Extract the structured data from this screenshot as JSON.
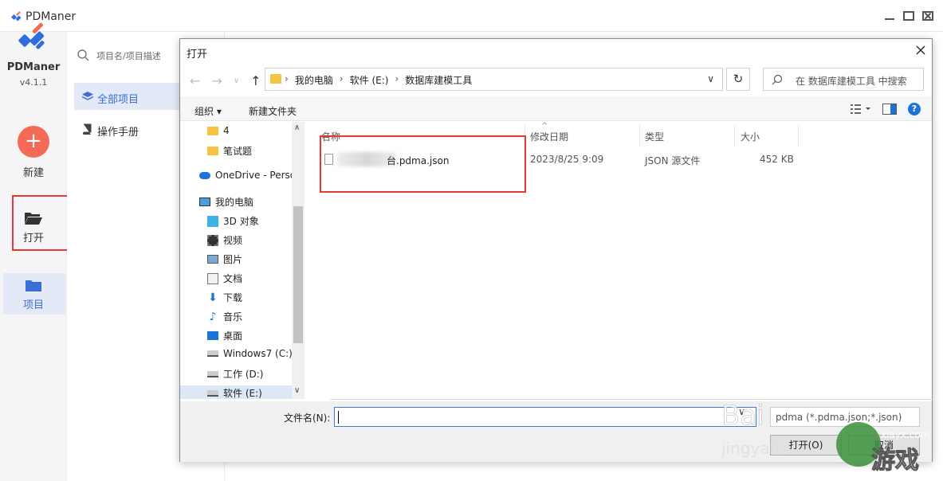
{
  "app": {
    "title": "PDManer",
    "brand": "PDManer",
    "version": "v4.1.1"
  },
  "sidebar": {
    "new_label": "新建",
    "open_label": "打开",
    "project_label": "项目"
  },
  "nav": {
    "search_placeholder": "项目名/项目描述",
    "items": [
      {
        "label": "全部项目"
      },
      {
        "label": "操作手册"
      }
    ]
  },
  "dialog": {
    "title": "打开",
    "breadcrumbs": [
      "我的电脑",
      "软件 (E:)",
      "数据库建模工具"
    ],
    "search_placeholder": "在 数据库建模工具 中搜索",
    "toolbar": {
      "organize": "组织 ▾",
      "new_folder": "新建文件夹"
    },
    "tree": [
      {
        "label": "4",
        "icon": "folder-icon"
      },
      {
        "label": "笔试题",
        "icon": "folder-icon"
      },
      {
        "label": "OneDrive - Perso",
        "icon": "cloud-icon"
      },
      {
        "label": "我的电脑",
        "icon": "computer-icon"
      },
      {
        "label": "3D 对象",
        "icon": "cube-icon"
      },
      {
        "label": "视频",
        "icon": "video-icon"
      },
      {
        "label": "图片",
        "icon": "picture-icon"
      },
      {
        "label": "文档",
        "icon": "document-icon"
      },
      {
        "label": "下载",
        "icon": "download-icon"
      },
      {
        "label": "音乐",
        "icon": "music-icon"
      },
      {
        "label": "桌面",
        "icon": "desktop-icon"
      },
      {
        "label": "Windows7 (C:)",
        "icon": "drive-icon"
      },
      {
        "label": "工作 (D:)",
        "icon": "drive-icon"
      },
      {
        "label": "软件 (E:)",
        "icon": "drive-icon"
      }
    ],
    "columns": [
      "名称",
      "修改日期",
      "类型",
      "大小"
    ],
    "files": [
      {
        "name": "台.pdma.json",
        "date": "2023/8/25 9:09",
        "type": "JSON 源文件",
        "size": "452 KB"
      }
    ],
    "filename_label": "文件名(N):",
    "filename_value": "",
    "filter": "pdma (*.pdma.json;*.json)",
    "open_button": "打开(O)",
    "cancel_button": "取消"
  },
  "watermark": {
    "text1": "Bai",
    "text2": "jingyan",
    "text3": "游戏",
    "text4": "xiayx.com"
  },
  "colors": {
    "accent": "#3c6fd6",
    "new_button": "#f46a57",
    "highlight_box": "#e53935"
  }
}
